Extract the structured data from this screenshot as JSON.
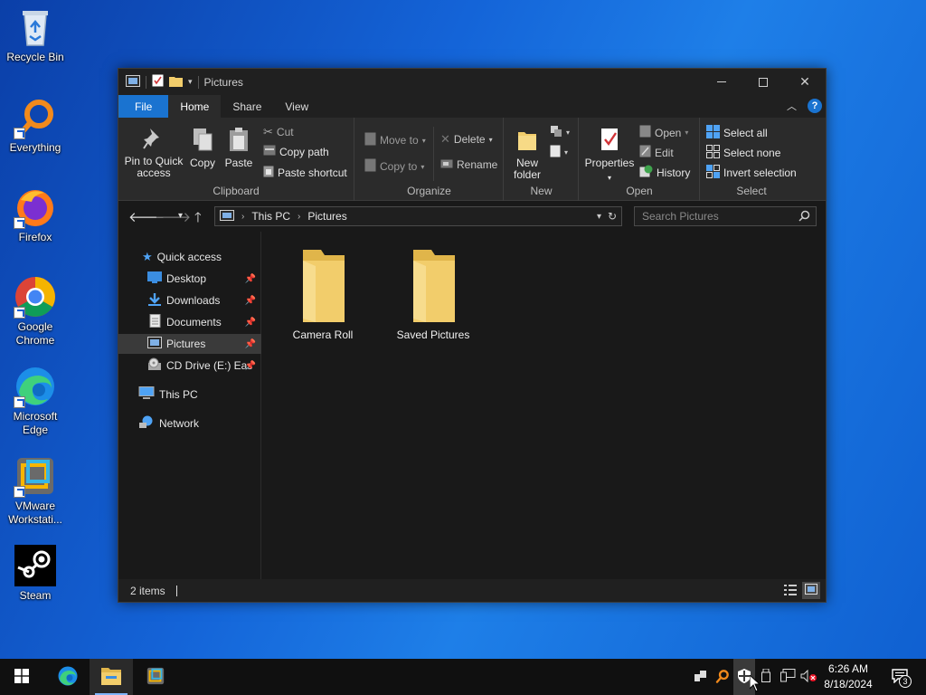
{
  "desktop": {
    "icons": [
      {
        "label": "Recycle Bin",
        "icon": "recycle-bin-icon"
      },
      {
        "label": "Everything",
        "icon": "everything-icon"
      },
      {
        "label": "Firefox",
        "icon": "firefox-icon"
      },
      {
        "label": "Google Chrome",
        "icon": "chrome-icon"
      },
      {
        "label": "Microsoft Edge",
        "icon": "edge-icon"
      },
      {
        "label": "VMware Workstati...",
        "icon": "vmware-icon"
      },
      {
        "label": "Steam",
        "icon": "steam-icon"
      }
    ]
  },
  "window": {
    "title": "Pictures",
    "tabs": {
      "file": "File",
      "home": "Home",
      "share": "Share",
      "view": "View"
    },
    "help": "?",
    "ribbon": {
      "clipboard": {
        "label": "Clipboard",
        "pin": "Pin to Quick access",
        "copy": "Copy",
        "paste": "Paste",
        "cut": "Cut",
        "copy_path": "Copy path",
        "paste_shortcut": "Paste shortcut"
      },
      "organize": {
        "label": "Organize",
        "move_to": "Move to",
        "copy_to": "Copy to",
        "delete": "Delete",
        "rename": "Rename"
      },
      "new": {
        "label": "New",
        "new_folder": "New folder"
      },
      "open": {
        "label": "Open",
        "properties": "Properties",
        "open": "Open",
        "edit": "Edit",
        "history": "History"
      },
      "select": {
        "label": "Select",
        "select_all": "Select all",
        "select_none": "Select none",
        "invert": "Invert selection"
      }
    },
    "address": {
      "crumbs": [
        "This PC",
        "Pictures"
      ],
      "search_placeholder": "Search Pictures"
    },
    "nav": {
      "quick_access": "Quick access",
      "items": [
        "Desktop",
        "Downloads",
        "Documents",
        "Pictures",
        "CD Drive (E:) Eas"
      ],
      "this_pc": "This PC",
      "network": "Network"
    },
    "folders": [
      "Camera Roll",
      "Saved Pictures"
    ],
    "status": "2 items"
  },
  "taskbar": {
    "time": "6:26 AM",
    "date": "8/18/2024",
    "notification_count": "3"
  },
  "colors": {
    "accent": "#1a73d0",
    "folder": "#f2cd6b",
    "window_bg": "#191919",
    "ribbon_bg": "#2b2b2b"
  }
}
